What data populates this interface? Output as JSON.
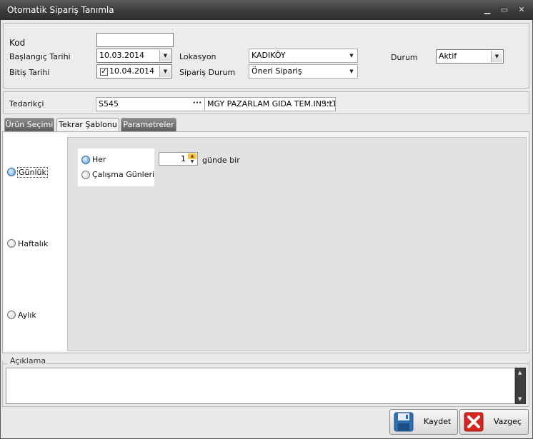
{
  "window": {
    "title": "Otomatik Sipariş Tanımla",
    "minimize_glyph": "▁",
    "maximize_glyph": "▭",
    "close_glyph": "✕"
  },
  "header": {
    "kod_label": "Kod",
    "kod_value": "",
    "baslangic_label": "Başlangıç Tarihi",
    "baslangic_value": "10.03.2014",
    "bitis_label": "Bitiş Tarihi",
    "bitis_value": "10.04.2014",
    "bitis_checked": true,
    "lokasyon_label": "Lokasyon",
    "lokasyon_value": "KADIKÖY",
    "siparis_durum_label": "Sipariş Durum",
    "siparis_durum_value": "Öneri Sipariş",
    "durum_label": "Durum",
    "durum_value": "Aktif"
  },
  "supplier": {
    "label": "Tedarikçi",
    "code": "S545",
    "name": "MGY PAZARLAM GIDA TEM.INS.LTD"
  },
  "tabs": [
    {
      "label": "Ürün Seçimi",
      "active": false
    },
    {
      "label": "Tekrar Şablonu",
      "active": true
    },
    {
      "label": "Parametreler",
      "active": false
    }
  ],
  "recurrence": {
    "periods": [
      {
        "label": "Günlük",
        "selected": true
      },
      {
        "label": "Haftalık",
        "selected": false
      },
      {
        "label": "Aylık",
        "selected": false
      }
    ],
    "daily_options": [
      {
        "label": "Her",
        "selected": true
      },
      {
        "label": "Çalışma Günleri",
        "selected": false
      }
    ],
    "interval_value": "1",
    "interval_suffix": "günde bir"
  },
  "notes": {
    "label": "Açıklama",
    "value": ""
  },
  "footer": {
    "save_label": "Kaydet",
    "cancel_label": "Vazgeç"
  },
  "colors": {
    "titlebar": "#3a3a3a",
    "background": "#e9e9e9",
    "save_icon": "#2f6fb3",
    "cancel_icon": "#d8261f"
  },
  "glyphs": {
    "dropdown": "▼",
    "ellipsis": "···",
    "check": "✓",
    "spin_up": "▲",
    "spin_down": "▼"
  }
}
